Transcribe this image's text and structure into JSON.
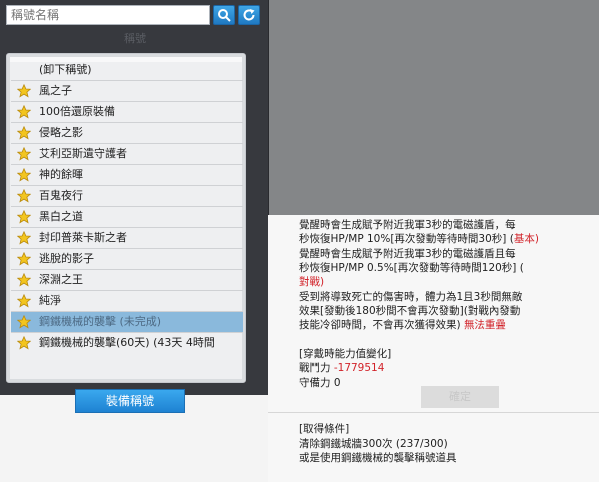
{
  "search": {
    "placeholder": "稱號名稱",
    "search_icon": "search-icon",
    "refresh_icon": "refresh-icon"
  },
  "section_header": "稱號",
  "list": {
    "items": [
      {
        "label": "(卸下稱號)",
        "star": false
      },
      {
        "label": "風之子",
        "star": true
      },
      {
        "label": "100倍還原裝備",
        "star": true
      },
      {
        "label": "侵略之影",
        "star": true
      },
      {
        "label": "艾利亞斯遺守護者",
        "star": true
      },
      {
        "label": "神的餘暉",
        "star": true
      },
      {
        "label": "百鬼夜行",
        "star": true
      },
      {
        "label": "黑白之道",
        "star": true
      },
      {
        "label": "封印普萊卡斯之者",
        "star": true
      },
      {
        "label": "逃脫的影子",
        "star": true
      },
      {
        "label": "深淵之王",
        "star": true
      },
      {
        "label": "純淨",
        "star": true
      },
      {
        "label": "鋼鐵機械的襲擊 (未完成)",
        "star": true,
        "selected": true
      },
      {
        "label": "鋼鐵機械的襲擊(60天) (43天 4時間",
        "star": true
      }
    ]
  },
  "equip_button": "裝備稱號",
  "tooltip": {
    "line1a": "覺醒時會生成賦予附近我軍3秒的電磁護盾，每",
    "line1b": "秒恢復HP/MP 10%[再次發動等待時間30秒] (",
    "line1b_red": "基本)",
    "line2a": "覺醒時會生成賦予附近我軍3秒的電磁護盾且每",
    "line2b": "秒恢復HP/MP 0.5%[再次發動等待時間120秒] (",
    "line2b_red": "對戰)",
    "line3a": "受到將導致死亡的傷害時，體力為1且3秒間無敵",
    "line3b": "效果[發動後180秒間不會再次發動](對戰內發動",
    "line3c": "技能冷卻時間，不會再次獲得效果) ",
    "line3c_red": "無法重疊",
    "stat_header": "[穿戴時能力值變化]",
    "combat_label": "戰鬥力 ",
    "combat_value": "-1779514",
    "defense_label": "守備力 0",
    "faded_button": "確定",
    "req_header": "[取得條件]",
    "req_line1": "清除鋼鐵城牆300次 (237/300)",
    "req_line2": "或是使用鋼鐵機械的襲擊稱號道具"
  },
  "colors": {
    "accent_blue": "#1e82d2",
    "selected_row": "#8ab9dc",
    "warning_red": "#d2232a",
    "star_gold": "#f3c51e"
  }
}
